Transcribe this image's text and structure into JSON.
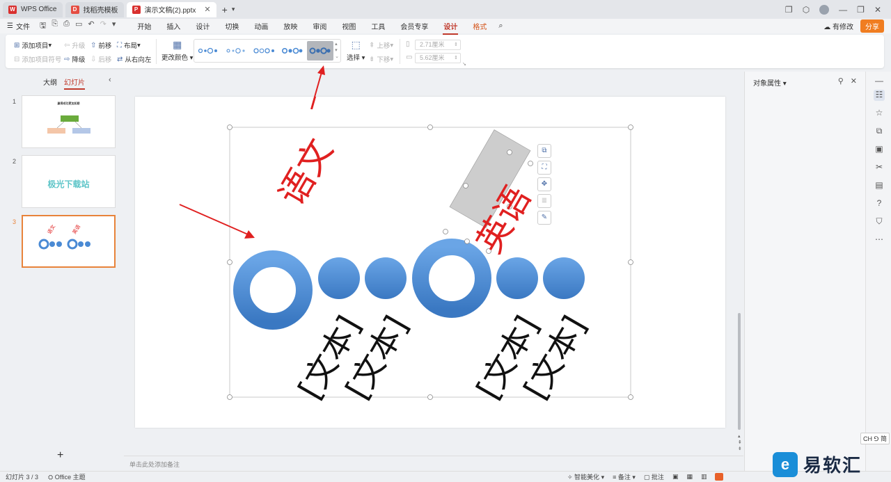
{
  "tabs": [
    {
      "label": "WPS Office",
      "logo": "W",
      "color": "#d9302f"
    },
    {
      "label": "找稻壳模板",
      "logo": "D",
      "color": "#e54d42"
    },
    {
      "label": "演示文稿(2).pptx",
      "logo": "P",
      "color": "#d9302f"
    }
  ],
  "menubar": {
    "file": "文件",
    "tabs": [
      "开始",
      "插入",
      "设计",
      "切换",
      "动画",
      "放映",
      "审阅",
      "视图",
      "工具",
      "会员专享",
      "设计",
      "格式"
    ],
    "modified": "有修改",
    "share": "分享"
  },
  "ribbon": {
    "add_item": "添加项目",
    "add_bullet": "添加项目符号",
    "upgrade": "升级",
    "downgrade": "降级",
    "move_forward": "前移",
    "move_backward": "后移",
    "layout": "布局",
    "right_to_left": "从右向左",
    "change_color": "更改颜色",
    "select": "选择",
    "move_up": "上移",
    "move_down": "下移",
    "height": "2.71厘米",
    "width": "5.62厘米"
  },
  "left_panel": {
    "outline_tab": "大纲",
    "slides_tab": "幻灯片",
    "slides": [
      {
        "num": "1",
        "title": "赢得成功更加如期"
      },
      {
        "num": "2",
        "title": "极光下载站"
      },
      {
        "num": "3",
        "title": ""
      }
    ],
    "slide3_labels": [
      "语文",
      "英语"
    ]
  },
  "slide": {
    "label_chinese": "语文",
    "label_english": "英语",
    "placeholder": "[文本]"
  },
  "notes_placeholder": "单击此处添加备注",
  "right_panel": {
    "title": "对象属性"
  },
  "input_badge": "CH ⅁ 简",
  "status": {
    "slide_count": "幻灯片 3 / 3",
    "theme": "Office 主题",
    "smart_beautify": "智能美化",
    "notes": "备注",
    "comments": "批注"
  },
  "watermark": {
    "logo": "e",
    "text": "易软汇"
  },
  "colors": {
    "accent": "#c0392b",
    "circle_blue": "#4a8ad4",
    "label_red": "#e02020"
  }
}
